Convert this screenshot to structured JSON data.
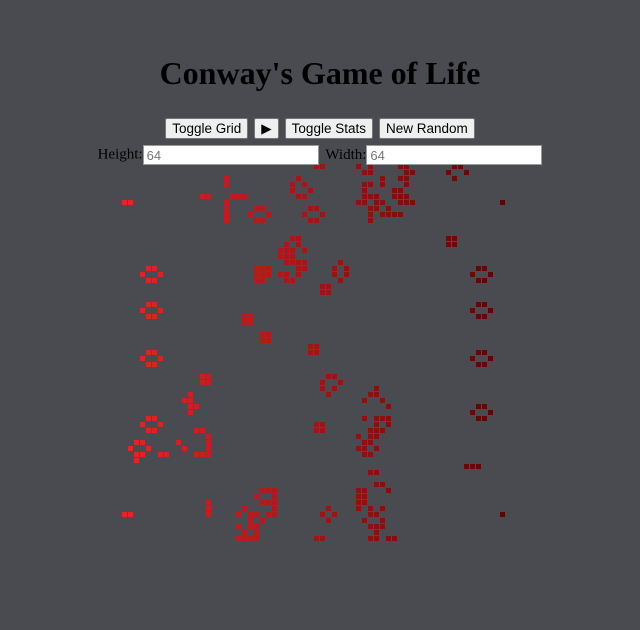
{
  "title": "Conway's Game of Life",
  "controls": {
    "toggle_grid": "Toggle Grid",
    "play": "▶",
    "toggle_stats": "Toggle Stats",
    "new_random": "New Random"
  },
  "dimensions": {
    "height_label": "Height:",
    "height_placeholder": "64",
    "width_label": "Width:",
    "width_placeholder": "64"
  },
  "colors": {
    "background": "#494b51",
    "cell_left": "#e02828",
    "cell_right": "#5a0606"
  },
  "board": {
    "rows": 64,
    "cols": 64,
    "live_cells": [
      [
        0,
        32
      ],
      [
        0,
        33
      ],
      [
        0,
        39
      ],
      [
        0,
        41
      ],
      [
        0,
        46
      ],
      [
        0,
        47
      ],
      [
        0,
        55
      ],
      [
        0,
        56
      ],
      [
        1,
        40
      ],
      [
        1,
        41
      ],
      [
        1,
        47
      ],
      [
        1,
        48
      ],
      [
        1,
        54
      ],
      [
        1,
        57
      ],
      [
        2,
        17
      ],
      [
        2,
        29
      ],
      [
        2,
        43
      ],
      [
        2,
        46
      ],
      [
        2,
        47
      ],
      [
        2,
        55
      ],
      [
        3,
        17
      ],
      [
        3,
        28
      ],
      [
        3,
        30
      ],
      [
        3,
        40
      ],
      [
        3,
        41
      ],
      [
        3,
        43
      ],
      [
        3,
        47
      ],
      [
        4,
        28
      ],
      [
        4,
        31
      ],
      [
        4,
        40
      ],
      [
        4,
        45
      ],
      [
        4,
        46
      ],
      [
        5,
        13
      ],
      [
        5,
        14
      ],
      [
        5,
        18
      ],
      [
        5,
        19
      ],
      [
        5,
        20
      ],
      [
        5,
        29
      ],
      [
        5,
        30
      ],
      [
        5,
        40
      ],
      [
        5,
        41
      ],
      [
        5,
        42
      ],
      [
        5,
        45
      ],
      [
        5,
        46
      ],
      [
        5,
        47
      ],
      [
        6,
        0
      ],
      [
        6,
        1
      ],
      [
        6,
        17
      ],
      [
        6,
        39
      ],
      [
        6,
        40
      ],
      [
        6,
        42
      ],
      [
        6,
        43
      ],
      [
        6,
        46
      ],
      [
        6,
        47
      ],
      [
        6,
        48
      ],
      [
        6,
        63
      ],
      [
        7,
        17
      ],
      [
        7,
        22
      ],
      [
        7,
        23
      ],
      [
        7,
        31
      ],
      [
        7,
        32
      ],
      [
        7,
        41
      ],
      [
        7,
        42
      ],
      [
        7,
        44
      ],
      [
        8,
        17
      ],
      [
        8,
        21
      ],
      [
        8,
        24
      ],
      [
        8,
        30
      ],
      [
        8,
        33
      ],
      [
        8,
        41
      ],
      [
        8,
        43
      ],
      [
        8,
        44
      ],
      [
        8,
        45
      ],
      [
        8,
        46
      ],
      [
        9,
        17
      ],
      [
        9,
        22
      ],
      [
        9,
        23
      ],
      [
        9,
        31
      ],
      [
        9,
        32
      ],
      [
        9,
        41
      ],
      [
        12,
        28
      ],
      [
        12,
        29
      ],
      [
        12,
        54
      ],
      [
        12,
        55
      ],
      [
        13,
        27
      ],
      [
        13,
        29
      ],
      [
        13,
        54
      ],
      [
        13,
        55
      ],
      [
        14,
        26
      ],
      [
        14,
        27
      ],
      [
        14,
        28
      ],
      [
        14,
        30
      ],
      [
        15,
        26
      ],
      [
        15,
        27
      ],
      [
        15,
        28
      ],
      [
        16,
        27
      ],
      [
        16,
        28
      ],
      [
        16,
        29
      ],
      [
        16,
        30
      ],
      [
        16,
        36
      ],
      [
        17,
        4
      ],
      [
        17,
        5
      ],
      [
        17,
        22
      ],
      [
        17,
        23
      ],
      [
        17,
        24
      ],
      [
        17,
        29
      ],
      [
        17,
        30
      ],
      [
        17,
        35
      ],
      [
        17,
        37
      ],
      [
        17,
        59
      ],
      [
        17,
        60
      ],
      [
        18,
        3
      ],
      [
        18,
        6
      ],
      [
        18,
        22
      ],
      [
        18,
        23
      ],
      [
        18,
        24
      ],
      [
        18,
        26
      ],
      [
        18,
        27
      ],
      [
        18,
        29
      ],
      [
        18,
        35
      ],
      [
        18,
        37
      ],
      [
        18,
        58
      ],
      [
        18,
        61
      ],
      [
        19,
        4
      ],
      [
        19,
        5
      ],
      [
        19,
        22
      ],
      [
        19,
        23
      ],
      [
        19,
        27
      ],
      [
        19,
        28
      ],
      [
        19,
        36
      ],
      [
        19,
        59
      ],
      [
        19,
        60
      ],
      [
        20,
        33
      ],
      [
        20,
        34
      ],
      [
        21,
        33
      ],
      [
        21,
        34
      ],
      [
        23,
        4
      ],
      [
        23,
        5
      ],
      [
        23,
        59
      ],
      [
        23,
        60
      ],
      [
        24,
        3
      ],
      [
        24,
        6
      ],
      [
        24,
        58
      ],
      [
        24,
        61
      ],
      [
        25,
        4
      ],
      [
        25,
        5
      ],
      [
        25,
        20
      ],
      [
        25,
        21
      ],
      [
        25,
        59
      ],
      [
        25,
        60
      ],
      [
        26,
        20
      ],
      [
        26,
        21
      ],
      [
        28,
        23
      ],
      [
        28,
        24
      ],
      [
        29,
        23
      ],
      [
        29,
        24
      ],
      [
        30,
        31
      ],
      [
        30,
        32
      ],
      [
        31,
        4
      ],
      [
        31,
        5
      ],
      [
        31,
        31
      ],
      [
        31,
        32
      ],
      [
        31,
        59
      ],
      [
        31,
        60
      ],
      [
        32,
        3
      ],
      [
        32,
        6
      ],
      [
        32,
        58
      ],
      [
        32,
        61
      ],
      [
        33,
        4
      ],
      [
        33,
        5
      ],
      [
        33,
        59
      ],
      [
        33,
        60
      ],
      [
        35,
        13
      ],
      [
        35,
        14
      ],
      [
        35,
        34
      ],
      [
        35,
        35
      ],
      [
        36,
        13
      ],
      [
        36,
        14
      ],
      [
        36,
        33
      ],
      [
        36,
        36
      ],
      [
        37,
        33
      ],
      [
        37,
        35
      ],
      [
        37,
        42
      ],
      [
        38,
        11
      ],
      [
        38,
        34
      ],
      [
        38,
        41
      ],
      [
        38,
        42
      ],
      [
        39,
        10
      ],
      [
        39,
        11
      ],
      [
        39,
        40
      ],
      [
        39,
        43
      ],
      [
        40,
        11
      ],
      [
        40,
        12
      ],
      [
        40,
        44
      ],
      [
        40,
        59
      ],
      [
        40,
        60
      ],
      [
        41,
        11
      ],
      [
        41,
        58
      ],
      [
        41,
        61
      ],
      [
        42,
        4
      ],
      [
        42,
        5
      ],
      [
        42,
        40
      ],
      [
        42,
        42
      ],
      [
        42,
        43
      ],
      [
        42,
        44
      ],
      [
        42,
        59
      ],
      [
        42,
        60
      ],
      [
        43,
        3
      ],
      [
        43,
        6
      ],
      [
        43,
        32
      ],
      [
        43,
        33
      ],
      [
        43,
        42
      ],
      [
        43,
        44
      ],
      [
        44,
        4
      ],
      [
        44,
        5
      ],
      [
        44,
        12
      ],
      [
        44,
        13
      ],
      [
        44,
        32
      ],
      [
        44,
        33
      ],
      [
        44,
        41
      ],
      [
        44,
        42
      ],
      [
        44,
        43
      ],
      [
        45,
        14
      ],
      [
        45,
        39
      ],
      [
        45,
        41
      ],
      [
        45,
        42
      ],
      [
        46,
        2
      ],
      [
        46,
        3
      ],
      [
        46,
        9
      ],
      [
        46,
        14
      ],
      [
        46,
        40
      ],
      [
        46,
        41
      ],
      [
        47,
        1
      ],
      [
        47,
        4
      ],
      [
        47,
        10
      ],
      [
        47,
        14
      ],
      [
        47,
        39
      ],
      [
        47,
        40
      ],
      [
        47,
        42
      ],
      [
        48,
        2
      ],
      [
        48,
        3
      ],
      [
        48,
        6
      ],
      [
        48,
        7
      ],
      [
        48,
        12
      ],
      [
        48,
        13
      ],
      [
        48,
        14
      ],
      [
        48,
        40
      ],
      [
        48,
        41
      ],
      [
        49,
        2
      ],
      [
        50,
        57
      ],
      [
        50,
        58
      ],
      [
        50,
        59
      ],
      [
        51,
        41
      ],
      [
        51,
        42
      ],
      [
        53,
        42
      ],
      [
        53,
        43
      ],
      [
        54,
        23
      ],
      [
        54,
        24
      ],
      [
        54,
        25
      ],
      [
        54,
        39
      ],
      [
        54,
        40
      ],
      [
        54,
        44
      ],
      [
        55,
        22
      ],
      [
        55,
        25
      ],
      [
        55,
        39
      ],
      [
        55,
        40
      ],
      [
        56,
        14
      ],
      [
        56,
        23
      ],
      [
        56,
        24
      ],
      [
        56,
        25
      ],
      [
        56,
        39
      ],
      [
        56,
        40
      ],
      [
        57,
        14
      ],
      [
        57,
        20
      ],
      [
        57,
        25
      ],
      [
        57,
        34
      ],
      [
        57,
        39
      ],
      [
        57,
        41
      ],
      [
        57,
        43
      ],
      [
        58,
        0
      ],
      [
        58,
        1
      ],
      [
        58,
        14
      ],
      [
        58,
        19
      ],
      [
        58,
        21
      ],
      [
        58,
        22
      ],
      [
        58,
        24
      ],
      [
        58,
        25
      ],
      [
        58,
        33
      ],
      [
        58,
        35
      ],
      [
        58,
        41
      ],
      [
        58,
        42
      ],
      [
        58,
        63
      ],
      [
        59,
        21
      ],
      [
        59,
        23
      ],
      [
        59,
        34
      ],
      [
        59,
        40
      ],
      [
        59,
        43
      ],
      [
        60,
        19
      ],
      [
        60,
        21
      ],
      [
        60,
        22
      ],
      [
        60,
        41
      ],
      [
        60,
        42
      ],
      [
        60,
        43
      ],
      [
        61,
        20
      ],
      [
        61,
        22
      ],
      [
        61,
        42
      ],
      [
        62,
        19
      ],
      [
        62,
        20
      ],
      [
        62,
        21
      ],
      [
        62,
        22
      ],
      [
        62,
        32
      ],
      [
        62,
        33
      ],
      [
        62,
        41
      ],
      [
        62,
        42
      ],
      [
        62,
        44
      ],
      [
        62,
        45
      ]
    ]
  }
}
